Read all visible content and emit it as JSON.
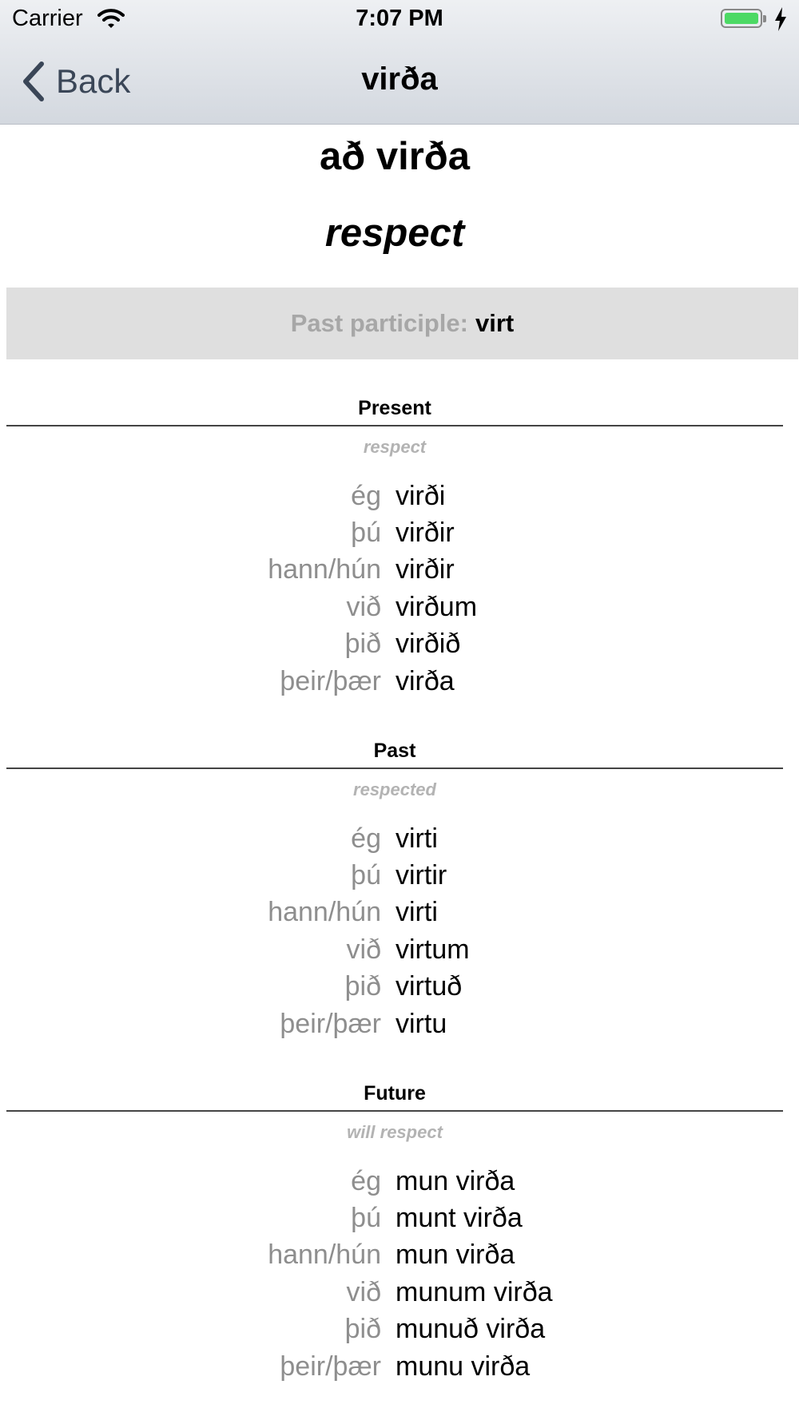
{
  "status_bar": {
    "carrier": "Carrier",
    "time": "7:07 PM",
    "icons": [
      "wifi-icon",
      "battery-icon",
      "charging-bolt-icon"
    ],
    "battery_level": 1.0,
    "battery_color": "#4cd964"
  },
  "nav": {
    "back_label": "Back",
    "title": "virða"
  },
  "verb": {
    "infinitive": "að virða",
    "translation": "respect",
    "participle_label": "Past participle:",
    "participle_value": "virt"
  },
  "tenses": [
    {
      "title": "Present",
      "gloss": "respect",
      "rows": [
        {
          "pronoun": "ég",
          "form": "virði"
        },
        {
          "pronoun": "þú",
          "form": "virðir"
        },
        {
          "pronoun": "hann/hún",
          "form": "virðir"
        },
        {
          "pronoun": "við",
          "form": "virðum"
        },
        {
          "pronoun": "þið",
          "form": "virðið"
        },
        {
          "pronoun": "þeir/þær",
          "form": "virða"
        }
      ]
    },
    {
      "title": "Past",
      "gloss": "respected",
      "rows": [
        {
          "pronoun": "ég",
          "form": "virti"
        },
        {
          "pronoun": "þú",
          "form": "virtir"
        },
        {
          "pronoun": "hann/hún",
          "form": "virti"
        },
        {
          "pronoun": "við",
          "form": "virtum"
        },
        {
          "pronoun": "þið",
          "form": "virtuð"
        },
        {
          "pronoun": "þeir/þær",
          "form": "virtu"
        }
      ]
    },
    {
      "title": "Future",
      "gloss": "will respect",
      "rows": [
        {
          "pronoun": "ég",
          "form": "mun virða"
        },
        {
          "pronoun": "þú",
          "form": "munt virða"
        },
        {
          "pronoun": "hann/hún",
          "form": "mun virða"
        },
        {
          "pronoun": "við",
          "form": "munum virða"
        },
        {
          "pronoun": "þið",
          "form": "munuð virða"
        },
        {
          "pronoun": "þeir/þær",
          "form": "munu virða"
        }
      ]
    }
  ],
  "colors": {
    "nav_tint": "#3a4657",
    "pronoun": "#8e8e8e",
    "gloss": "#b3b3b3",
    "participle_bg": "#dfdfdf",
    "participle_label": "#a7a7a7"
  }
}
